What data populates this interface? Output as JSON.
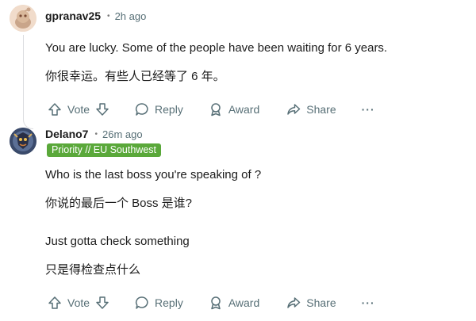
{
  "comments": [
    {
      "username": "gpranav25",
      "separator": "•",
      "time": "2h ago",
      "lines": [
        "You are lucky. Some of the people have been waiting for 6 years.",
        "你很幸运。有些人已经等了 6 年。"
      ],
      "actions": {
        "vote": "Vote",
        "reply": "Reply",
        "award": "Award",
        "share": "Share",
        "more": "···"
      }
    },
    {
      "username": "Delano7",
      "separator": "•",
      "time": "26m ago",
      "flair": "Priority // EU Southwest",
      "lines": [
        "Who is the last boss you're speaking of ?",
        "你说的最后一个 Boss 是谁?",
        "Just gotta check something",
        "只是得检查点什么"
      ],
      "actions": {
        "vote": "Vote",
        "reply": "Reply",
        "award": "Award",
        "share": "Share",
        "more": "···"
      }
    }
  ],
  "colors": {
    "flair_bg": "#5aa83a",
    "meta_text": "#576f76",
    "thread_line": "#dcdde0"
  }
}
